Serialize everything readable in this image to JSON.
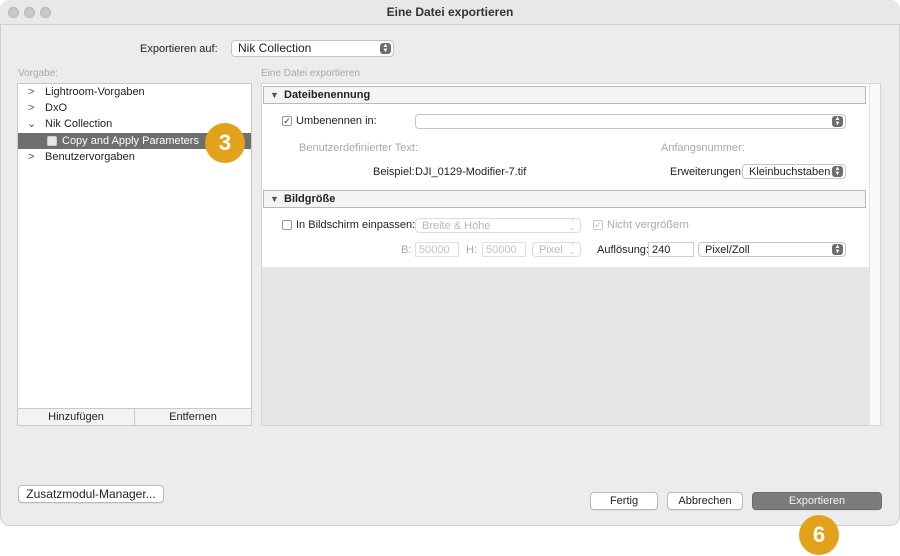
{
  "window": {
    "title": "Eine Datei exportieren"
  },
  "export_to": {
    "label": "Exportieren auf:",
    "value": "Nik Collection"
  },
  "presets": {
    "label": "Vorgabe:",
    "items": [
      {
        "label": "Lightroom-Vorgaben",
        "expanded": false
      },
      {
        "label": "DxO",
        "expanded": false
      },
      {
        "label": "Nik Collection",
        "expanded": true
      },
      {
        "label": "Copy and Apply Parameters",
        "selected": true
      },
      {
        "label": "Benutzervorgaben",
        "expanded": false
      }
    ],
    "add_label": "Hinzufügen",
    "remove_label": "Entfernen"
  },
  "main": {
    "header": "Eine Datei exportieren"
  },
  "file_naming": {
    "title": "Dateibenennung",
    "rename_label": "Umbenennen in:",
    "rename_checked": true,
    "rename_value": "",
    "custom_text_label": "Benutzerdefinierter Text:",
    "start_number_label": "Anfangsnummer:",
    "example_label": "Beispiel:",
    "example_value": "DJI_0129-Modifier-7.tif",
    "extensions_label": "Erweiterungen:",
    "extensions_value": "Kleinbuchstaben"
  },
  "image_size": {
    "title": "Bildgröße",
    "fit_label": "In Bildschirm einpassen:",
    "fit_checked": false,
    "fit_value": "Breite & Höhe",
    "no_enlarge_label": "Nicht vergrößern",
    "no_enlarge_checked": true,
    "w_label": "B:",
    "w_value": "50000",
    "h_label": "H:",
    "h_value": "50000",
    "unit_value": "Pixel",
    "resolution_label": "Auflösung:",
    "resolution_value": "240",
    "resolution_unit": "Pixel/Zoll"
  },
  "footer": {
    "plugin_manager_label": "Zusatzmodul-Manager...",
    "done_label": "Fertig",
    "cancel_label": "Abbrechen",
    "export_label": "Exportieren"
  },
  "annotations": {
    "badge_1": "3",
    "badge_2": "6"
  },
  "colors": {
    "badge": "#e2a21b",
    "selection": "#6f6f6f"
  }
}
